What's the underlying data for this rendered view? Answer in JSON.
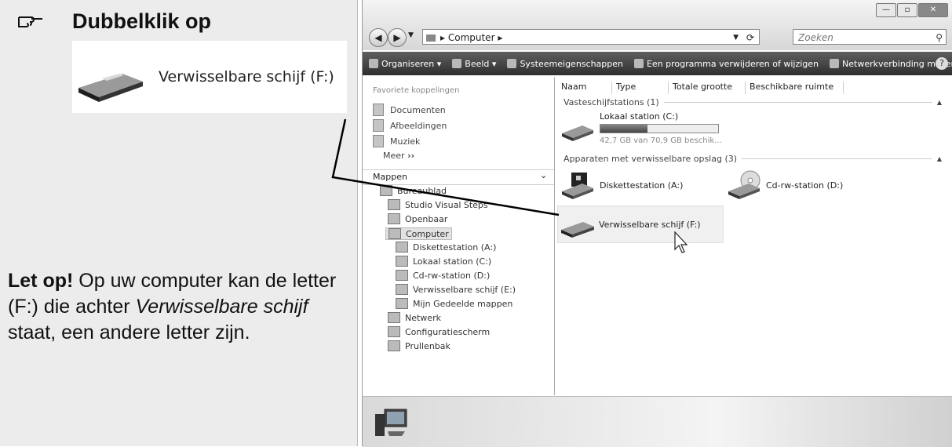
{
  "instruction": {
    "title": "Dubbelklik op",
    "zoom_label": "Verwisselbare schijf (F:)"
  },
  "note": {
    "bold": "Let op!",
    "part1": " Op uw computer kan de letter (F:) die achter ",
    "italic": "Verwisselbare schijf",
    "part2": " staat, een andere letter zijn."
  },
  "window": {
    "address": "Computer",
    "search_placeholder": "Zoeken",
    "toolbar": [
      "Organiseren",
      "Beeld",
      "Systeemeigenschappen",
      "Een programma verwijderen of wijzigen",
      "Netwerkverbinding maken",
      "»"
    ],
    "favorites_header": "Favoriete koppelingen",
    "favorites": [
      "Documenten",
      "Afbeeldingen",
      "Muziek"
    ],
    "meer": "Meer",
    "mappen": "Mappen",
    "tree": [
      "Bureaublad",
      "Studio Visual Steps",
      "Openbaar",
      "Computer",
      "Diskettestation (A:)",
      "Lokaal station (C:)",
      "Cd-rw-station (D:)",
      "Verwisselbare schijf (E:)",
      "Mijn Gedeelde mappen",
      "Netwerk",
      "Configuratiescherm",
      "Prullenbak"
    ],
    "columns": [
      "Naam",
      "Type",
      "Totale grootte",
      "Beschikbare ruimte"
    ],
    "group1": "Vasteschijfstations (1)",
    "local_drive": {
      "name": "Lokaal station (C:)",
      "info": "42,7 GB van 70,9 GB beschik...",
      "used_fraction": 0.4
    },
    "group2": "Apparaten met verwisselbare opslag (3)",
    "devices": [
      "Diskettestation (A:)",
      "Cd-rw-station (D:)",
      "Verwisselbare schijf (F:)"
    ]
  }
}
